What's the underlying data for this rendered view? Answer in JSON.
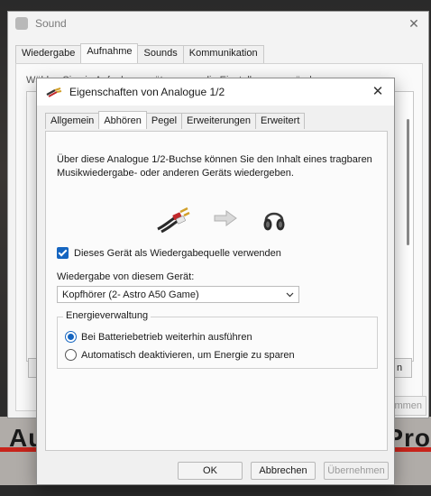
{
  "background": {
    "left_word": "Au",
    "right_word": "Pro"
  },
  "sound_window": {
    "title": "Sound",
    "tabs": [
      "Wiedergabe",
      "Aufnahme",
      "Sounds",
      "Kommunikation"
    ],
    "active_tab": "Aufnahme",
    "instruction": "Wählen Sie ein Aufnahmegerät aus, um die Einstellungen zu ändern:",
    "btn_left": "K",
    "btn_right": "n",
    "apply_fragment": "mmen"
  },
  "dialog": {
    "title": "Eigenschaften von Analogue 1/2",
    "tabs": [
      "Allgemein",
      "Abhören",
      "Pegel",
      "Erweiterungen",
      "Erweitert"
    ],
    "active_tab": "Abhören",
    "description": "Über diese Analogue 1/2-Buchse können Sie den Inhalt eines tragbaren Musikwiedergabe- oder anderen Geräts wiedergeben.",
    "checkbox_label": "Dieses Gerät als Wiedergabequelle verwenden",
    "checkbox_checked": true,
    "playback_label": "Wiedergabe von diesem Gerät:",
    "playback_selected": "Kopfhörer (2- Astro A50 Game)",
    "power_group_title": "Energieverwaltung",
    "power_options": [
      {
        "label": "Bei Batteriebetrieb weiterhin ausführen",
        "selected": true
      },
      {
        "label": "Automatisch deaktivieren, um Energie zu sparen",
        "selected": false
      }
    ],
    "buttons": {
      "ok": "OK",
      "cancel": "Abbrechen",
      "apply": "Übernehmen"
    },
    "icons": [
      "rca-cable-icon",
      "arrow-right-icon",
      "headphones-icon"
    ],
    "accent_color": "#1565c0"
  }
}
